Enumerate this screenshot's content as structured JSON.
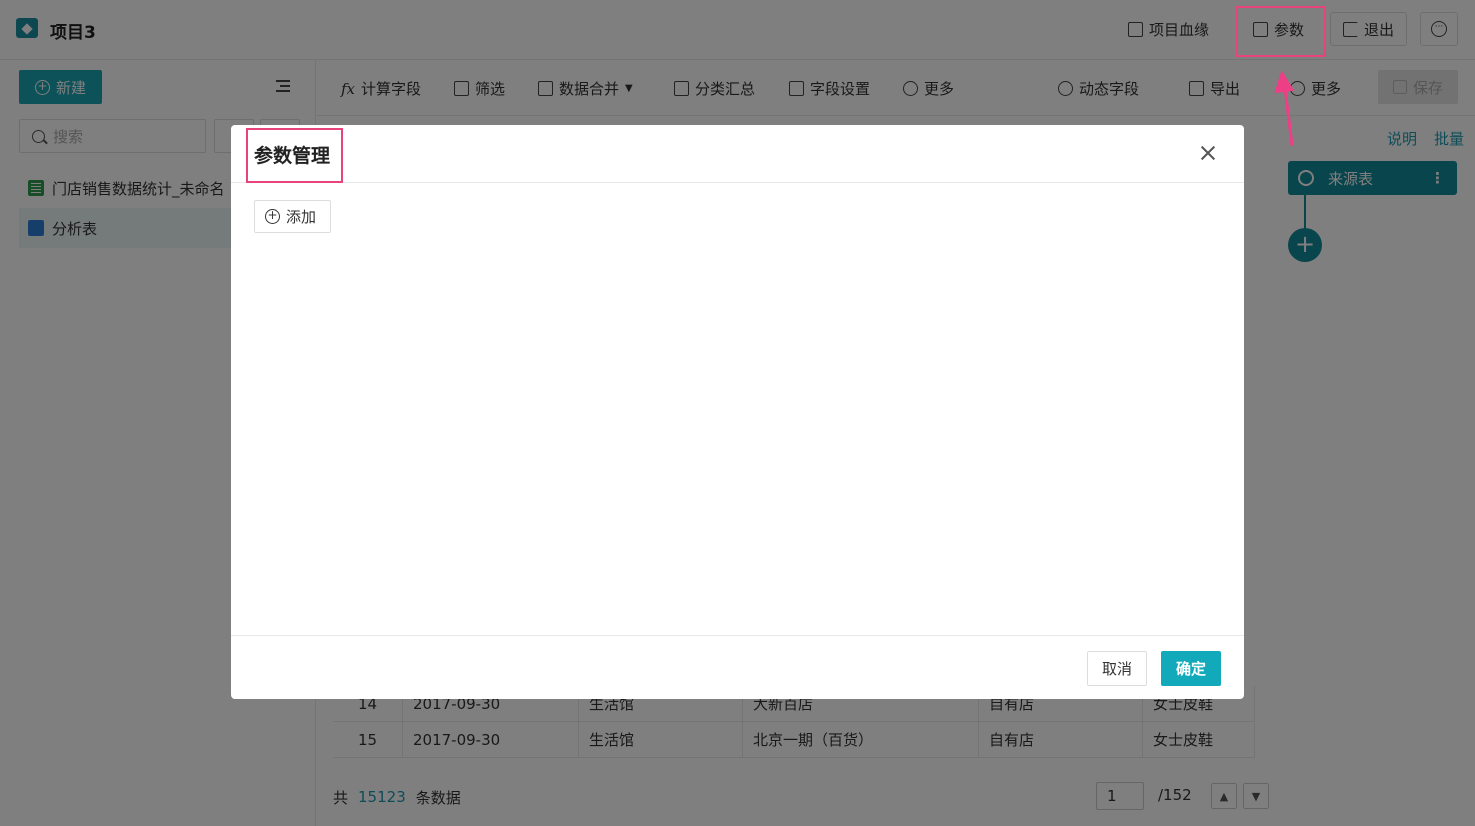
{
  "header": {
    "project_title": "项目3",
    "lineage_label": "项目血缘",
    "params_label": "参数",
    "exit_label": "退出",
    "more_symbol": "···"
  },
  "sidebar": {
    "new_label": "新建",
    "search_placeholder": "搜索",
    "items": [
      {
        "label": "门店销售数据统计_未命名",
        "icon": "sheet-icon"
      },
      {
        "label": "分析表",
        "icon": "chart-icon"
      }
    ]
  },
  "toolbar": {
    "calc_field": "计算字段",
    "calc_prefix": "fx",
    "filter": "筛选",
    "merge": "数据合并",
    "group_summary": "分类汇总",
    "field_settings": "字段设置",
    "more_left": "更多",
    "dynamic_field": "动态字段",
    "export": "导出",
    "more_right": "更多",
    "save": "保存"
  },
  "side_links": {
    "explain": "说明",
    "batch": "批量"
  },
  "flow": {
    "source_node": "来源表",
    "add_symbol": "+"
  },
  "table": {
    "rows": [
      {
        "index": "14",
        "date": "2017-09-30",
        "category": "生活馆",
        "store": "大新百店",
        "type": "自有店",
        "product": "女士皮鞋"
      },
      {
        "index": "15",
        "date": "2017-09-30",
        "category": "生活馆",
        "store": "北京一期（百货）",
        "type": "自有店",
        "product": "女士皮鞋"
      }
    ]
  },
  "footer": {
    "prefix": "共",
    "count": "15123",
    "suffix": "条数据",
    "page": "1",
    "total_pages": "/152"
  },
  "modal": {
    "title": "参数管理",
    "add_label": "添加",
    "cancel_label": "取消",
    "ok_label": "确定"
  },
  "colors": {
    "accent": "#1aa3b3",
    "highlight": "#e8437a",
    "overlay": "rgba(0,0,0,0.5)"
  }
}
